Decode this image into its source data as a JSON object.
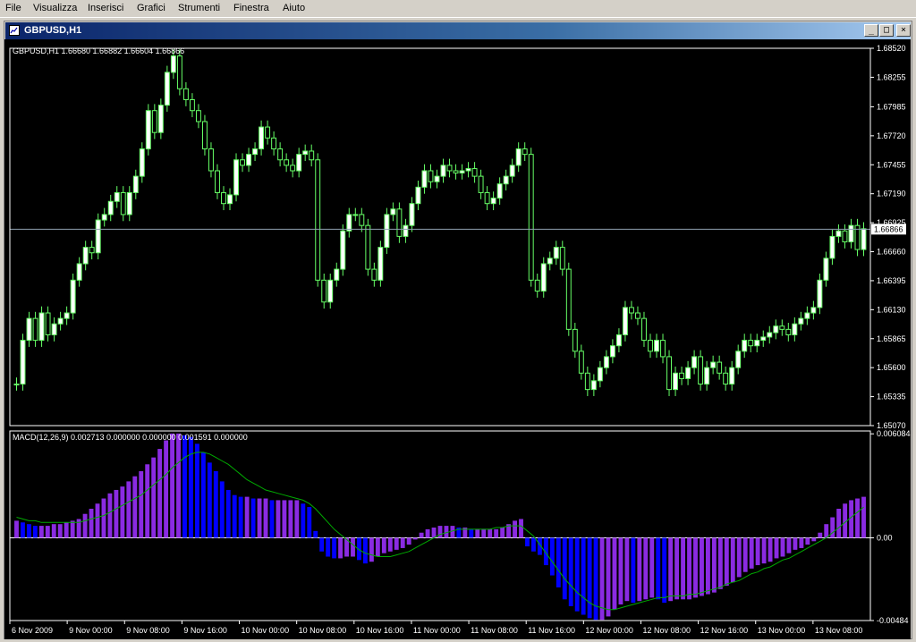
{
  "menu": {
    "items": [
      {
        "label": "File"
      },
      {
        "label": "Visualizza"
      },
      {
        "label": "Inserisci"
      },
      {
        "label": "Grafici"
      },
      {
        "label": "Strumenti"
      },
      {
        "label": "Finestra"
      },
      {
        "label": "Aiuto"
      }
    ]
  },
  "window": {
    "title": "GBPUSD,H1",
    "buttons": {
      "minimize": "_",
      "restore": "□",
      "close": "×"
    }
  },
  "colors": {
    "background": "#000000",
    "candle_up": "#ffffff",
    "candle_outline": "#66ff66",
    "histogram_purple": "#8a2be2",
    "histogram_blue": "#0000ff",
    "signal_line": "#00aa00",
    "axis": "#ffffff",
    "bid_line": "#8fa0b0"
  },
  "chart_data": [
    {
      "type": "candlestick",
      "title": "GBPUSD,H1  1.66680 1.66882 1.66604 1.66866",
      "ylim": [
        1.6507,
        1.6852
      ],
      "y_ticks": [
        "1.68520",
        "1.68255",
        "1.67985",
        "1.67720",
        "1.67455",
        "1.67190",
        "1.66925",
        "1.66660",
        "1.66395",
        "1.66130",
        "1.65865",
        "1.65600",
        "1.65335",
        "1.65070"
      ],
      "current_price": "1.66866",
      "x_ticks": [
        "6 Nov 2009",
        "9 Nov 00:00",
        "9 Nov 08:00",
        "9 Nov 16:00",
        "10 Nov 00:00",
        "10 Nov 08:00",
        "10 Nov 16:00",
        "11 Nov 00:00",
        "11 Nov 08:00",
        "11 Nov 16:00",
        "12 Nov 00:00",
        "12 Nov 08:00",
        "12 Nov 16:00",
        "13 Nov 00:00",
        "13 Nov 08:00"
      ],
      "close": [
        1.6545,
        1.6585,
        1.6605,
        1.6585,
        1.661,
        1.659,
        1.66,
        1.6605,
        1.661,
        1.664,
        1.6655,
        1.667,
        1.6665,
        1.6695,
        1.67,
        1.6712,
        1.672,
        1.67,
        1.672,
        1.6735,
        1.676,
        1.6795,
        1.6775,
        1.68,
        1.683,
        1.6845,
        1.6815,
        1.6805,
        1.6795,
        1.6785,
        1.676,
        1.674,
        1.672,
        1.671,
        1.6718,
        1.675,
        1.6745,
        1.6755,
        1.676,
        1.678,
        1.677,
        1.676,
        1.675,
        1.6745,
        1.674,
        1.6755,
        1.6758,
        1.675,
        1.664,
        1.662,
        1.664,
        1.665,
        1.6685,
        1.67,
        1.67,
        1.669,
        1.665,
        1.664,
        1.667,
        1.67,
        1.6705,
        1.668,
        1.669,
        1.671,
        1.6725,
        1.674,
        1.673,
        1.6735,
        1.6745,
        1.674,
        1.6738,
        1.674,
        1.6742,
        1.6735,
        1.672,
        1.671,
        1.6715,
        1.6728,
        1.6735,
        1.6745,
        1.676,
        1.6755,
        1.664,
        1.663,
        1.6655,
        1.666,
        1.667,
        1.665,
        1.6595,
        1.6575,
        1.6555,
        1.654,
        1.6548,
        1.656,
        1.657,
        1.658,
        1.659,
        1.6615,
        1.661,
        1.6605,
        1.6585,
        1.6575,
        1.6585,
        1.657,
        1.654,
        1.6555,
        1.655,
        1.656,
        1.657,
        1.6545,
        1.656,
        1.6565,
        1.6555,
        1.6545,
        1.656,
        1.6575,
        1.6585,
        1.658,
        1.6585,
        1.6588,
        1.6592,
        1.6598,
        1.6595,
        1.659,
        1.66,
        1.6605,
        1.661,
        1.6615,
        1.664,
        1.666,
        1.668,
        1.6685,
        1.6675,
        1.669,
        1.6668,
        1.6687
      ]
    },
    {
      "type": "bar",
      "title": "MACD(12,26,9) 0.002713 0.000000 0.000000 0.001591 0.000000",
      "ylim": [
        -0.00484,
        0.00625
      ],
      "y_ticks": [
        "0.006084",
        "0.00",
        "-0.00484"
      ],
      "values": [
        0.001,
        0.0009,
        0.0008,
        0.0007,
        0.0007,
        0.0007,
        0.0008,
        0.0008,
        0.0009,
        0.001,
        0.0011,
        0.0014,
        0.0017,
        0.002,
        0.0023,
        0.0026,
        0.0028,
        0.003,
        0.0033,
        0.0036,
        0.0039,
        0.0043,
        0.0047,
        0.0052,
        0.0057,
        0.0061,
        0.0061,
        0.006,
        0.0059,
        0.0055,
        0.005,
        0.0044,
        0.0039,
        0.0033,
        0.0028,
        0.0025,
        0.0024,
        0.0024,
        0.0023,
        0.0023,
        0.0023,
        0.0022,
        0.0022,
        0.0022,
        0.0022,
        0.0022,
        0.002,
        0.0018,
        0.0004,
        -0.0008,
        -0.0011,
        -0.0012,
        -0.0012,
        -0.0011,
        -0.0011,
        -0.0013,
        -0.0015,
        -0.0014,
        -0.0011,
        -0.0009,
        -0.0008,
        -0.0007,
        -0.0006,
        -0.0004,
        -0.0001,
        0.0003,
        0.0005,
        0.0006,
        0.0007,
        0.0007,
        0.0007,
        0.0006,
        0.0006,
        0.0005,
        0.0005,
        0.0005,
        0.0005,
        0.0005,
        0.0006,
        0.0008,
        0.001,
        0.0011,
        -0.0005,
        -0.0008,
        -0.001,
        -0.0016,
        -0.0022,
        -0.0029,
        -0.0036,
        -0.004,
        -0.0043,
        -0.0045,
        -0.0047,
        -0.0048,
        -0.0048,
        -0.0046,
        -0.0042,
        -0.0039,
        -0.0037,
        -0.0038,
        -0.0037,
        -0.0036,
        -0.0035,
        -0.0036,
        -0.0038,
        -0.0037,
        -0.0036,
        -0.0036,
        -0.0036,
        -0.0035,
        -0.0034,
        -0.0033,
        -0.0032,
        -0.003,
        -0.0028,
        -0.0026,
        -0.0023,
        -0.002,
        -0.0018,
        -0.0016,
        -0.0015,
        -0.0014,
        -0.0012,
        -0.0011,
        -0.0009,
        -0.0007,
        -0.0006,
        -0.0004,
        -0.0002,
        0.0003,
        0.0008,
        0.0012,
        0.0017,
        0.002,
        0.0022,
        0.0023,
        0.0024
      ],
      "signal": [
        0.0012,
        0.0011,
        0.001,
        0.001,
        0.0009,
        0.0009,
        0.0009,
        0.0009,
        0.0009,
        0.0009,
        0.0009,
        0.001,
        0.0011,
        0.0012,
        0.0013,
        0.0015,
        0.0017,
        0.0019,
        0.0021,
        0.0023,
        0.0025,
        0.0028,
        0.0031,
        0.0034,
        0.0037,
        0.0041,
        0.0044,
        0.0047,
        0.0049,
        0.005,
        0.005,
        0.0049,
        0.0047,
        0.0045,
        0.0043,
        0.004,
        0.0037,
        0.0034,
        0.0032,
        0.003,
        0.0028,
        0.0027,
        0.0026,
        0.0025,
        0.0024,
        0.0023,
        0.0022,
        0.002,
        0.0017,
        0.0013,
        0.0009,
        0.0005,
        0.0002,
        -0.0001,
        -0.0004,
        -0.0007,
        -0.0009,
        -0.001,
        -0.0011,
        -0.0011,
        -0.0011,
        -0.001,
        -0.0009,
        -0.0008,
        -0.0006,
        -0.0004,
        -0.0002,
        0.0,
        0.0002,
        0.0003,
        0.0004,
        0.0005,
        0.0005,
        0.0005,
        0.0005,
        0.0005,
        0.0005,
        0.0006,
        0.0006,
        0.0007,
        0.0007,
        0.0007,
        0.0004,
        0.0001,
        -0.0004,
        -0.0009,
        -0.0014,
        -0.0019,
        -0.0024,
        -0.0028,
        -0.0032,
        -0.0035,
        -0.0038,
        -0.004,
        -0.0041,
        -0.0042,
        -0.0042,
        -0.0041,
        -0.004,
        -0.0039,
        -0.0038,
        -0.0037,
        -0.0036,
        -0.0035,
        -0.0035,
        -0.0034,
        -0.0034,
        -0.0034,
        -0.0033,
        -0.0033,
        -0.0032,
        -0.0031,
        -0.003,
        -0.0029,
        -0.0027,
        -0.0026,
        -0.0025,
        -0.0023,
        -0.0021,
        -0.002,
        -0.0018,
        -0.0017,
        -0.0015,
        -0.0013,
        -0.0012,
        -0.001,
        -0.0008,
        -0.0006,
        -0.0004,
        -0.0002,
        0.0,
        0.0003,
        0.0006,
        0.0009,
        0.0012,
        0.0015,
        0.0018
      ]
    }
  ]
}
